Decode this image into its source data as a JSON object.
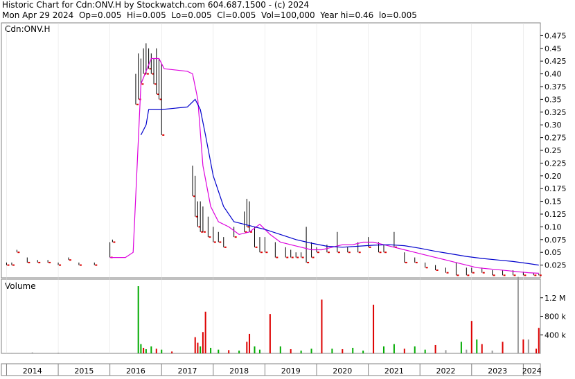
{
  "header": {
    "line1": "Historic Chart for Cdn:ONV.H by Stockwatch.com 604.687.1500 - (c) 2024",
    "line2": "Mon Apr 29 2024  Op=0.005  Hi=0.005  Lo=0.005  Cl=0.005  Vol=100,000  Year hi=0.46  lo=0.005"
  },
  "colors": {
    "price_bar": "#000000",
    "price_down_marker": "#dd0000",
    "ma_fast": "#dd00dd",
    "ma_slow": "#0000cc",
    "volume_up": "#00aa00",
    "volume_down": "#dd0000",
    "volume_neutral": "#999999",
    "grid": "#808080"
  },
  "chart_data": [
    {
      "type": "line",
      "title": "Cdn:ONV.H",
      "x_ticks": [
        "2014",
        "2015",
        "2016",
        "2017",
        "2018",
        "2019",
        "2020",
        "2021",
        "2022",
        "2023",
        "2024"
      ],
      "xlim": [
        2013.9,
        2024.33
      ],
      "ylim": [
        0,
        0.5
      ],
      "y_ticks": [
        "0.475",
        "0.45",
        "0.425",
        "0.40",
        "0.375",
        "0.35",
        "0.325",
        "0.30",
        "0.275",
        "0.25",
        "0.225",
        "0.20",
        "0.175",
        "0.15",
        "0.125",
        "0.10",
        "0.075",
        "0.05",
        "0.025"
      ],
      "series": [
        {
          "style": "hlc-bars",
          "x": [
            2014.0,
            2014.1,
            2014.2,
            2014.4,
            2014.6,
            2014.8,
            2015.0,
            2015.2,
            2015.4,
            2015.7,
            2016.0,
            2016.05,
            2016.5,
            2016.55,
            2016.6,
            2016.65,
            2016.7,
            2016.75,
            2016.8,
            2016.85,
            2016.9,
            2016.95,
            2017.0,
            2017.6,
            2017.65,
            2017.7,
            2017.75,
            2017.8,
            2017.9,
            2018.0,
            2018.1,
            2018.2,
            2018.4,
            2018.6,
            2018.65,
            2018.7,
            2018.8,
            2018.9,
            2019.0,
            2019.2,
            2019.4,
            2019.5,
            2019.6,
            2019.7,
            2019.8,
            2019.9,
            2020.0,
            2020.2,
            2020.4,
            2020.6,
            2020.8,
            2021.0,
            2021.2,
            2021.3,
            2021.5,
            2021.7,
            2021.9,
            2022.1,
            2022.3,
            2022.5,
            2022.7,
            2022.9,
            2023.0,
            2023.2,
            2023.4,
            2023.6,
            2023.8,
            2024.0,
            2024.2,
            2024.3
          ],
          "high": [
            0.03,
            0.03,
            0.055,
            0.04,
            0.035,
            0.035,
            0.03,
            0.04,
            0.03,
            0.03,
            0.07,
            0.075,
            0.4,
            0.44,
            0.43,
            0.45,
            0.46,
            0.45,
            0.44,
            0.43,
            0.45,
            0.43,
            0.42,
            0.22,
            0.2,
            0.15,
            0.15,
            0.14,
            0.12,
            0.1,
            0.09,
            0.08,
            0.1,
            0.13,
            0.155,
            0.15,
            0.1,
            0.08,
            0.08,
            0.07,
            0.06,
            0.055,
            0.05,
            0.05,
            0.1,
            0.07,
            0.06,
            0.065,
            0.09,
            0.06,
            0.07,
            0.08,
            0.07,
            0.065,
            0.09,
            0.05,
            0.04,
            0.03,
            0.025,
            0.02,
            0.03,
            0.02,
            0.02,
            0.02,
            0.015,
            0.015,
            0.015,
            0.012,
            0.01,
            0.008
          ],
          "low": [
            0.025,
            0.025,
            0.05,
            0.03,
            0.03,
            0.03,
            0.025,
            0.035,
            0.025,
            0.025,
            0.04,
            0.07,
            0.34,
            0.35,
            0.38,
            0.4,
            0.4,
            0.41,
            0.4,
            0.38,
            0.36,
            0.35,
            0.28,
            0.16,
            0.12,
            0.1,
            0.09,
            0.09,
            0.08,
            0.07,
            0.07,
            0.06,
            0.08,
            0.09,
            0.1,
            0.09,
            0.06,
            0.05,
            0.05,
            0.04,
            0.04,
            0.04,
            0.04,
            0.04,
            0.03,
            0.04,
            0.05,
            0.05,
            0.05,
            0.05,
            0.05,
            0.06,
            0.05,
            0.05,
            0.06,
            0.03,
            0.03,
            0.02,
            0.015,
            0.01,
            0.005,
            0.005,
            0.01,
            0.01,
            0.005,
            0.005,
            0.005,
            0.005,
            0.005,
            0.005
          ]
        },
        {
          "name": "",
          "style": "moving-average-fast",
          "x": [
            2016.0,
            2016.3,
            2016.45,
            2016.6,
            2016.8,
            2016.95,
            2017.05,
            2017.5,
            2017.6,
            2017.7,
            2017.8,
            2017.95,
            2018.1,
            2018.3,
            2018.5,
            2018.7,
            2018.9,
            2019.1,
            2019.3,
            2019.5,
            2019.7,
            2019.9,
            2020.1,
            2020.3,
            2020.5,
            2020.7,
            2020.9,
            2021.1,
            2021.3,
            2021.5,
            2021.7,
            2021.9,
            2022.1,
            2022.3,
            2022.5,
            2022.7,
            2022.9,
            2023.1,
            2023.3,
            2023.5,
            2023.7,
            2023.9,
            2024.1,
            2024.3
          ],
          "y": [
            0.04,
            0.04,
            0.05,
            0.38,
            0.43,
            0.43,
            0.41,
            0.405,
            0.4,
            0.35,
            0.22,
            0.14,
            0.11,
            0.1,
            0.085,
            0.09,
            0.105,
            0.085,
            0.07,
            0.065,
            0.06,
            0.055,
            0.055,
            0.06,
            0.065,
            0.065,
            0.07,
            0.07,
            0.065,
            0.06,
            0.055,
            0.05,
            0.045,
            0.04,
            0.035,
            0.03,
            0.025,
            0.02,
            0.018,
            0.016,
            0.014,
            0.012,
            0.01,
            0.009
          ]
        },
        {
          "name": "",
          "style": "moving-average-slow",
          "x": [
            2016.6,
            2016.7,
            2016.75,
            2017.0,
            2017.5,
            2017.65,
            2017.75,
            2017.85,
            2018.0,
            2018.2,
            2018.4,
            2018.6,
            2018.8,
            2019.0,
            2019.3,
            2019.6,
            2019.9,
            2020.2,
            2020.5,
            2020.8,
            2021.1,
            2021.4,
            2021.7,
            2022.0,
            2022.3,
            2022.6,
            2022.9,
            2023.2,
            2023.5,
            2023.8,
            2024.1,
            2024.3
          ],
          "y": [
            0.28,
            0.3,
            0.33,
            0.33,
            0.335,
            0.35,
            0.33,
            0.28,
            0.2,
            0.14,
            0.11,
            0.105,
            0.1,
            0.095,
            0.085,
            0.075,
            0.068,
            0.062,
            0.06,
            0.062,
            0.064,
            0.065,
            0.063,
            0.058,
            0.052,
            0.047,
            0.042,
            0.038,
            0.035,
            0.032,
            0.028,
            0.025
          ]
        }
      ]
    },
    {
      "type": "bar",
      "title": "Volume",
      "ylim": [
        0,
        1600000
      ],
      "y_ticks": [
        "1.2 M",
        "800 k",
        "400 k"
      ],
      "x": [
        2014.1,
        2014.5,
        2015.0,
        2015.5,
        2016.55,
        2016.6,
        2016.65,
        2016.7,
        2016.8,
        2016.9,
        2017.0,
        2017.2,
        2017.65,
        2017.7,
        2017.75,
        2017.8,
        2017.85,
        2017.95,
        2018.1,
        2018.3,
        2018.5,
        2018.65,
        2018.7,
        2018.8,
        2018.9,
        2019.1,
        2019.3,
        2019.5,
        2019.7,
        2019.9,
        2020.1,
        2020.3,
        2020.5,
        2020.7,
        2020.9,
        2021.1,
        2021.3,
        2021.5,
        2021.7,
        2021.9,
        2022.1,
        2022.3,
        2022.5,
        2022.8,
        2022.9,
        2023.0,
        2023.1,
        2023.2,
        2023.4,
        2023.6,
        2023.9,
        2024.0,
        2024.1,
        2024.25,
        2024.3
      ],
      "values": [
        10000,
        20000,
        15000,
        10000,
        1450000,
        200000,
        120000,
        90000,
        150000,
        100000,
        80000,
        40000,
        350000,
        230000,
        150000,
        460000,
        900000,
        120000,
        80000,
        70000,
        60000,
        250000,
        420000,
        150000,
        80000,
        850000,
        150000,
        90000,
        60000,
        100000,
        1160000,
        100000,
        90000,
        120000,
        60000,
        1050000,
        150000,
        200000,
        100000,
        150000,
        80000,
        180000,
        70000,
        250000,
        80000,
        700000,
        300000,
        200000,
        60000,
        250000,
        1650000,
        300000,
        300000,
        100000,
        550000
      ],
      "colors": [
        "volume_neutral",
        "volume_neutral",
        "volume_neutral",
        "volume_neutral",
        "volume_up",
        "volume_up",
        "volume_down",
        "volume_up",
        "volume_up",
        "volume_down",
        "volume_up",
        "volume_down",
        "volume_down",
        "volume_down",
        "volume_up",
        "volume_down",
        "volume_down",
        "volume_up",
        "volume_up",
        "volume_down",
        "volume_up",
        "volume_down",
        "volume_down",
        "volume_up",
        "volume_up",
        "volume_down",
        "volume_up",
        "volume_down",
        "volume_up",
        "volume_up",
        "volume_down",
        "volume_up",
        "volume_down",
        "volume_up",
        "volume_up",
        "volume_down",
        "volume_up",
        "volume_up",
        "volume_down",
        "volume_up",
        "volume_up",
        "volume_down",
        "volume_neutral",
        "volume_up",
        "volume_neutral",
        "volume_down",
        "volume_up",
        "volume_down",
        "volume_neutral",
        "volume_down",
        "volume_neutral",
        "volume_down",
        "volume_neutral",
        "volume_down",
        "volume_down"
      ]
    }
  ]
}
